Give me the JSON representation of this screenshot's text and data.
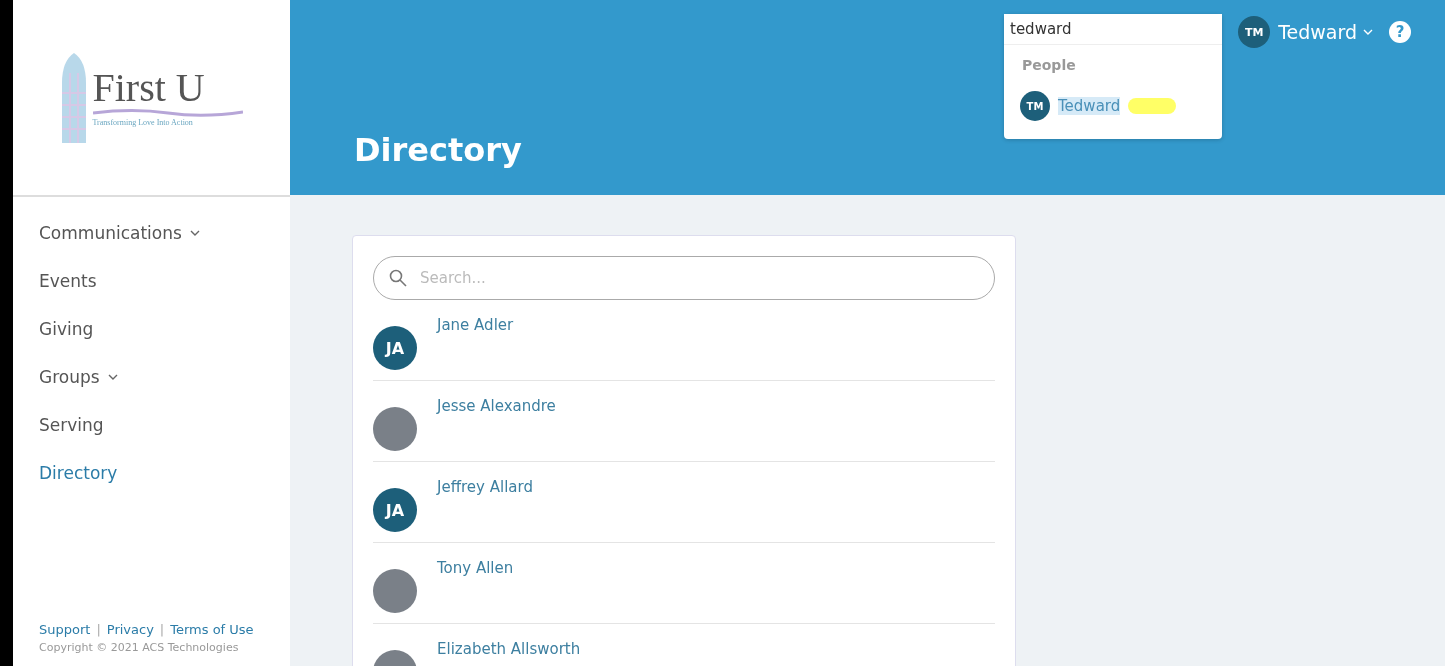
{
  "logo": {
    "name": "First U",
    "tagline": "Transforming Love Into Action"
  },
  "sidebar": {
    "items": [
      {
        "label": "Communications",
        "has_menu": true,
        "selected": false
      },
      {
        "label": "Events",
        "has_menu": false,
        "selected": false
      },
      {
        "label": "Giving",
        "has_menu": false,
        "selected": false
      },
      {
        "label": "Groups",
        "has_menu": true,
        "selected": false
      },
      {
        "label": "Serving",
        "has_menu": false,
        "selected": false
      },
      {
        "label": "Directory",
        "has_menu": false,
        "selected": true
      }
    ],
    "footer_links": [
      "Support",
      "Privacy",
      "Terms of Use"
    ],
    "separator": "|",
    "copyright": "Copyright © 2021 ACS Technologies"
  },
  "header": {
    "title": "Directory",
    "user": {
      "initials": "TM",
      "name": "Tedward"
    },
    "help": "?"
  },
  "global_search": {
    "value": "tedward",
    "section": "People",
    "results": [
      {
        "initials": "TM",
        "name": "Tedward",
        "redacted": true
      }
    ]
  },
  "directory": {
    "search_placeholder": "Search...",
    "people": [
      {
        "name": "Jane Adler",
        "kind": "initials",
        "initials": "JA"
      },
      {
        "name": "Jesse Alexandre",
        "kind": "photo"
      },
      {
        "name": "Jeffrey Allard",
        "kind": "initials",
        "initials": "JA"
      },
      {
        "name": "Tony Allen",
        "kind": "photo"
      },
      {
        "name": "Elizabeth Allsworth",
        "kind": "photo"
      }
    ]
  }
}
